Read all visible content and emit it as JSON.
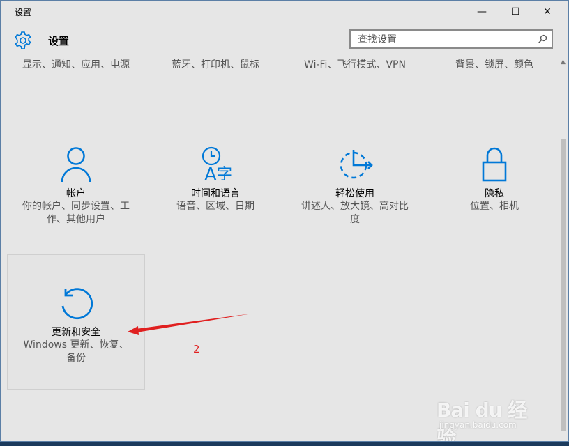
{
  "window": {
    "title": "设置",
    "minimize_glyph": "—",
    "maximize_glyph": "☐",
    "close_glyph": "✕"
  },
  "header": {
    "title": "设置",
    "icon": "gear-icon"
  },
  "search": {
    "placeholder": "查找设置",
    "icon": "search-icon"
  },
  "top_row": {
    "items": [
      {
        "label": "显示、通知、应用、电源"
      },
      {
        "label": "蓝牙、打印机、鼠标"
      },
      {
        "label": "Wi-Fi、飞行模式、VPN"
      },
      {
        "label": "背景、锁屏、颜色"
      }
    ]
  },
  "tiles": {
    "accounts": {
      "title": "帐户",
      "desc": "你的帐户、同步设置、工作、其他用户",
      "icon": "person-icon"
    },
    "time": {
      "title": "时间和语言",
      "desc": "语音、区域、日期",
      "icon": "time-language-icon"
    },
    "ease": {
      "title": "轻松使用",
      "desc": "讲述人、放大镜、高对比度",
      "icon": "ease-of-access-icon"
    },
    "privacy": {
      "title": "隐私",
      "desc": "位置、相机",
      "icon": "lock-icon"
    },
    "update": {
      "title": "更新和安全",
      "desc": "Windows 更新、恢复、备份",
      "icon": "refresh-icon"
    }
  },
  "annotation": {
    "label": "2",
    "color": "#e02020"
  },
  "watermark": {
    "brand": "Bai du 经验",
    "url": "jingyan.baidu.com"
  },
  "colors": {
    "accent": "#0078d7",
    "window_bg": "#e6e6e6",
    "desc_text": "#555555"
  }
}
